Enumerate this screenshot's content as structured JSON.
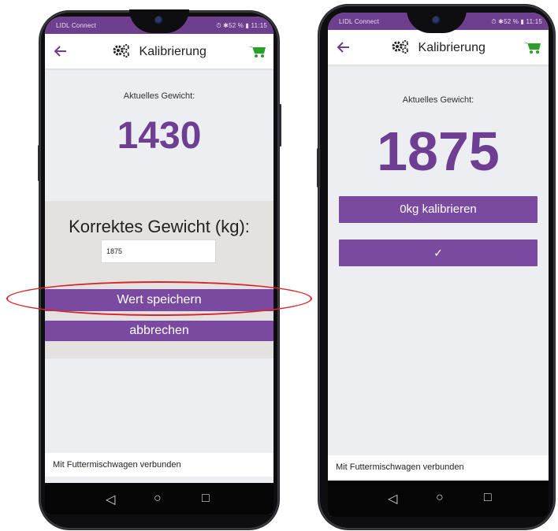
{
  "colors": {
    "accent_purple": "#7a4aa0",
    "status_purple": "#6f3f8f",
    "number_purple": "#6e3e92",
    "cart_green": "#2c9e2c",
    "highlight_red": "#d7262b"
  },
  "screens": [
    {
      "status": {
        "left": "LIDL Connect",
        "right": "⏱ ✱52 % ▮ 11:15"
      },
      "appbar": {
        "title": "Kalibrierung",
        "back_icon": "arrow-left-icon",
        "cart_icon": "wheelbarrow-icon"
      },
      "current_weight_label": "Aktuelles Gewicht:",
      "current_weight": "1430",
      "correct_weight_label": "Korrektes Gewicht (kg):",
      "input_value": "1875",
      "save_button": "Wert speichern",
      "cancel_button": "abbrechen",
      "footer": "Mit Futtermischwagen verbunden"
    },
    {
      "status": {
        "left": "LIDL Connect",
        "right": "⏱ ✱52 % ▮ 11:15"
      },
      "appbar": {
        "title": "Kalibrierung",
        "back_icon": "arrow-left-icon",
        "cart_icon": "wheelbarrow-icon"
      },
      "current_weight_label": "Aktuelles Gewicht:",
      "current_weight": "1875",
      "calibrate_button": "0kg kalibrieren",
      "confirm_button": "✓",
      "footer": "Mit Futtermischwagen verbunden"
    }
  ],
  "navbar": {
    "back": "◁",
    "home": "○",
    "recent": "□"
  }
}
